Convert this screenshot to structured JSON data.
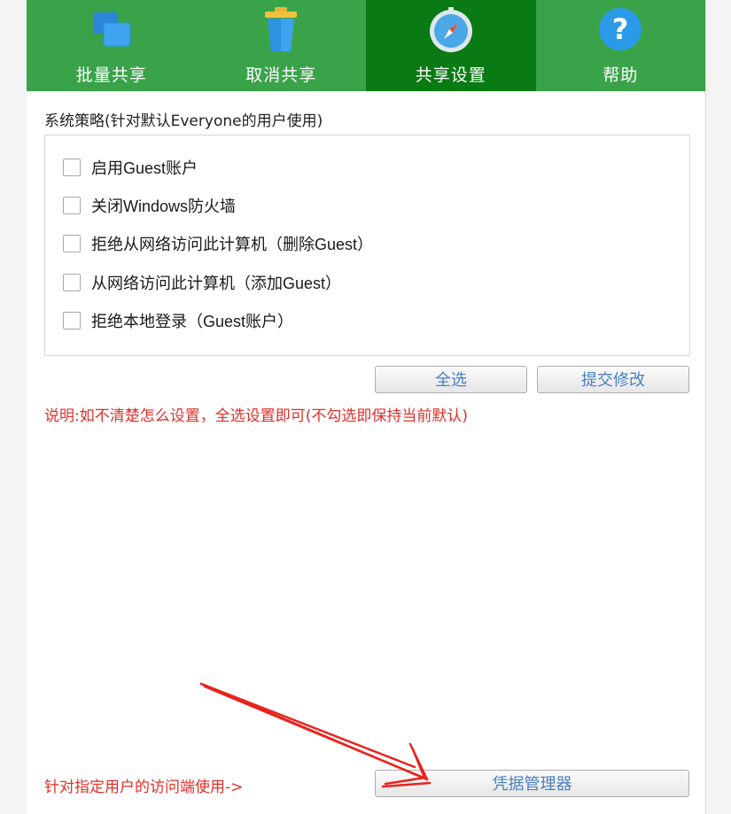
{
  "tabs": [
    {
      "label": "批量共享",
      "icon": "share-windows-icon"
    },
    {
      "label": "取消共享",
      "icon": "trash-bin-icon"
    },
    {
      "label": "共享设置",
      "icon": "compass-icon"
    },
    {
      "label": "帮助",
      "icon": "help-question-icon"
    }
  ],
  "active_tab": 2,
  "policy": {
    "title": "系统策略(针对默认Everyone的用户使用)",
    "options": [
      {
        "label": "启用Guest账户",
        "checked": false
      },
      {
        "label": "关闭Windows防火墙",
        "checked": false
      },
      {
        "label": "拒绝从网络访问此计算机（删除Guest）",
        "checked": false
      },
      {
        "label": "从网络访问此计算机（添加Guest）",
        "checked": false
      },
      {
        "label": "拒绝本地登录（Guest账户）",
        "checked": false
      }
    ]
  },
  "buttons": {
    "select_all": "全选",
    "submit": "提交修改",
    "credential_manager": "凭据管理器"
  },
  "note": "说明:如不清楚怎么设置，全选设置即可(不勾选即保持当前默认)",
  "bottom_note": "针对指定用户的访问端使用->",
  "colors": {
    "tab_bar": "#3aa34a",
    "tab_active": "#0a7a14",
    "note_red": "#e0302a",
    "button_text": "#4a7fc1",
    "arrow_red": "#e8231d"
  }
}
